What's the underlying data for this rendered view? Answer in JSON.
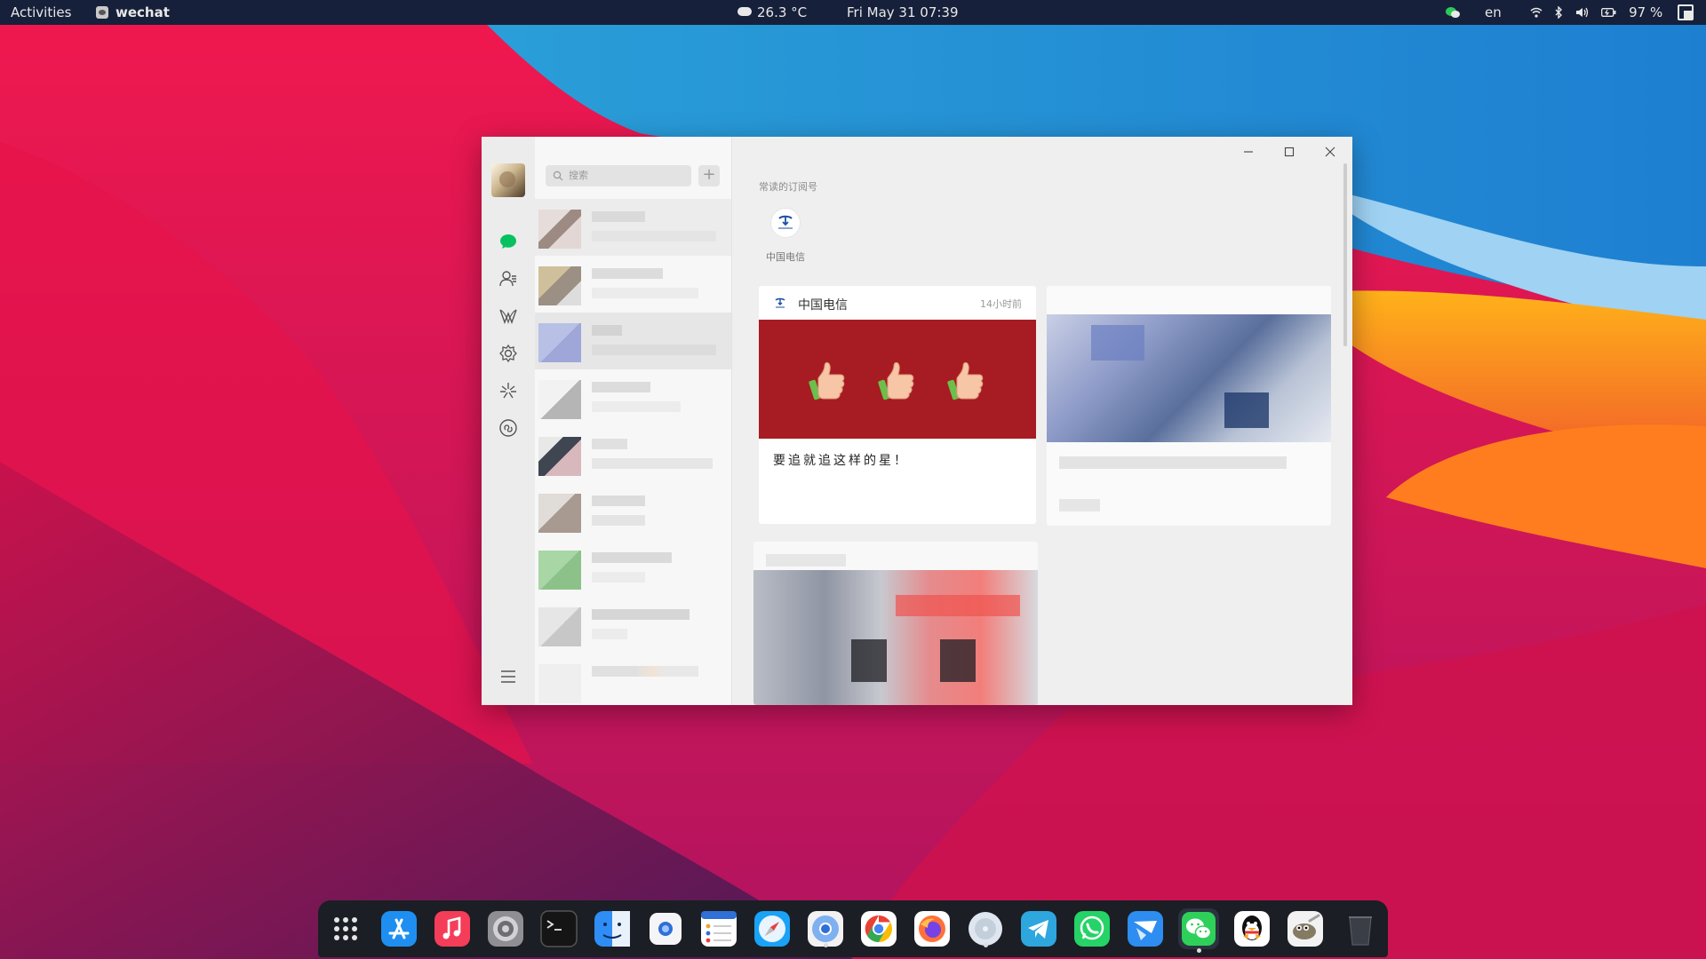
{
  "colors": {
    "topbar_bg": "#16203a",
    "wechat_green": "#07c160",
    "card_banner_red": "#a61c22",
    "dock_bg": "#1b1e24"
  },
  "topbar": {
    "activities": "Activities",
    "app_name": "wechat",
    "weather": "26.3 °C",
    "clock": "Fri May 31  07:39",
    "lang": "en",
    "battery": "97 %",
    "status_icons": [
      "wechat-tray-icon",
      "wifi-icon",
      "bluetooth-icon",
      "volume-icon",
      "battery-icon"
    ]
  },
  "wechat": {
    "search_placeholder": "搜索",
    "add_label": "+",
    "nav_icons": [
      "chat-icon",
      "contacts-icon",
      "favorites-icon",
      "settings-gear-icon",
      "moments-icon",
      "mini-programs-icon",
      "menu-icon"
    ],
    "section_title": "常读的订阅号",
    "frequent_subscription": {
      "name": "中国电信"
    },
    "article_card": {
      "account": "中国电信",
      "time": "14小时前",
      "title": "要追就追这样的星！",
      "banner_emoji": "👍"
    }
  },
  "dock": {
    "apps": [
      "app-grid-icon",
      "app-store-icon",
      "music-icon",
      "system-settings-icon",
      "terminal-icon",
      "finder-icon",
      "screenshot-icon",
      "reminders-icon",
      "safari-icon",
      "chromium-icon",
      "chrome-icon",
      "firefox-icon",
      "disk-icon",
      "telegram-icon",
      "whatsapp-icon",
      "feishu-icon",
      "wechat-icon",
      "qq-icon",
      "gimp-icon",
      "trash-icon"
    ]
  }
}
